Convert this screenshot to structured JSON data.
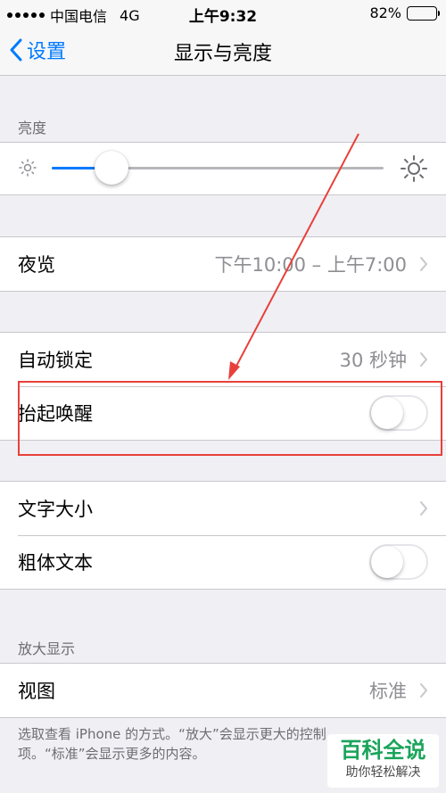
{
  "status_bar": {
    "carrier": "中国电信",
    "network": "4G",
    "time": "上午9:32",
    "battery_text": "82%",
    "battery_level": 0.82
  },
  "nav": {
    "back_label": "设置",
    "title": "显示与亮度"
  },
  "brightness": {
    "section_label": "亮度",
    "level": 0.18,
    "accent_color": "#007aff"
  },
  "night_shift": {
    "label": "夜览",
    "value": "下午10:00 – 上午7:00"
  },
  "auto_lock": {
    "label": "自动锁定",
    "value": "30 秒钟"
  },
  "raise_to_wake": {
    "label": "抬起唤醒",
    "enabled": false
  },
  "text_size": {
    "label": "文字大小"
  },
  "bold_text": {
    "label": "粗体文本",
    "enabled": false
  },
  "zoom": {
    "section_label": "放大显示",
    "view_label": "视图",
    "view_value": "标准",
    "footer_line1": "选取查看 iPhone 的方式。“放大”会显示更大的控制",
    "footer_line2": "项。“标准”会显示更多的内容。"
  },
  "annotation": {
    "color": "#e8403a"
  },
  "watermark": {
    "big": "百科全说",
    "small": "助你轻松解决"
  }
}
